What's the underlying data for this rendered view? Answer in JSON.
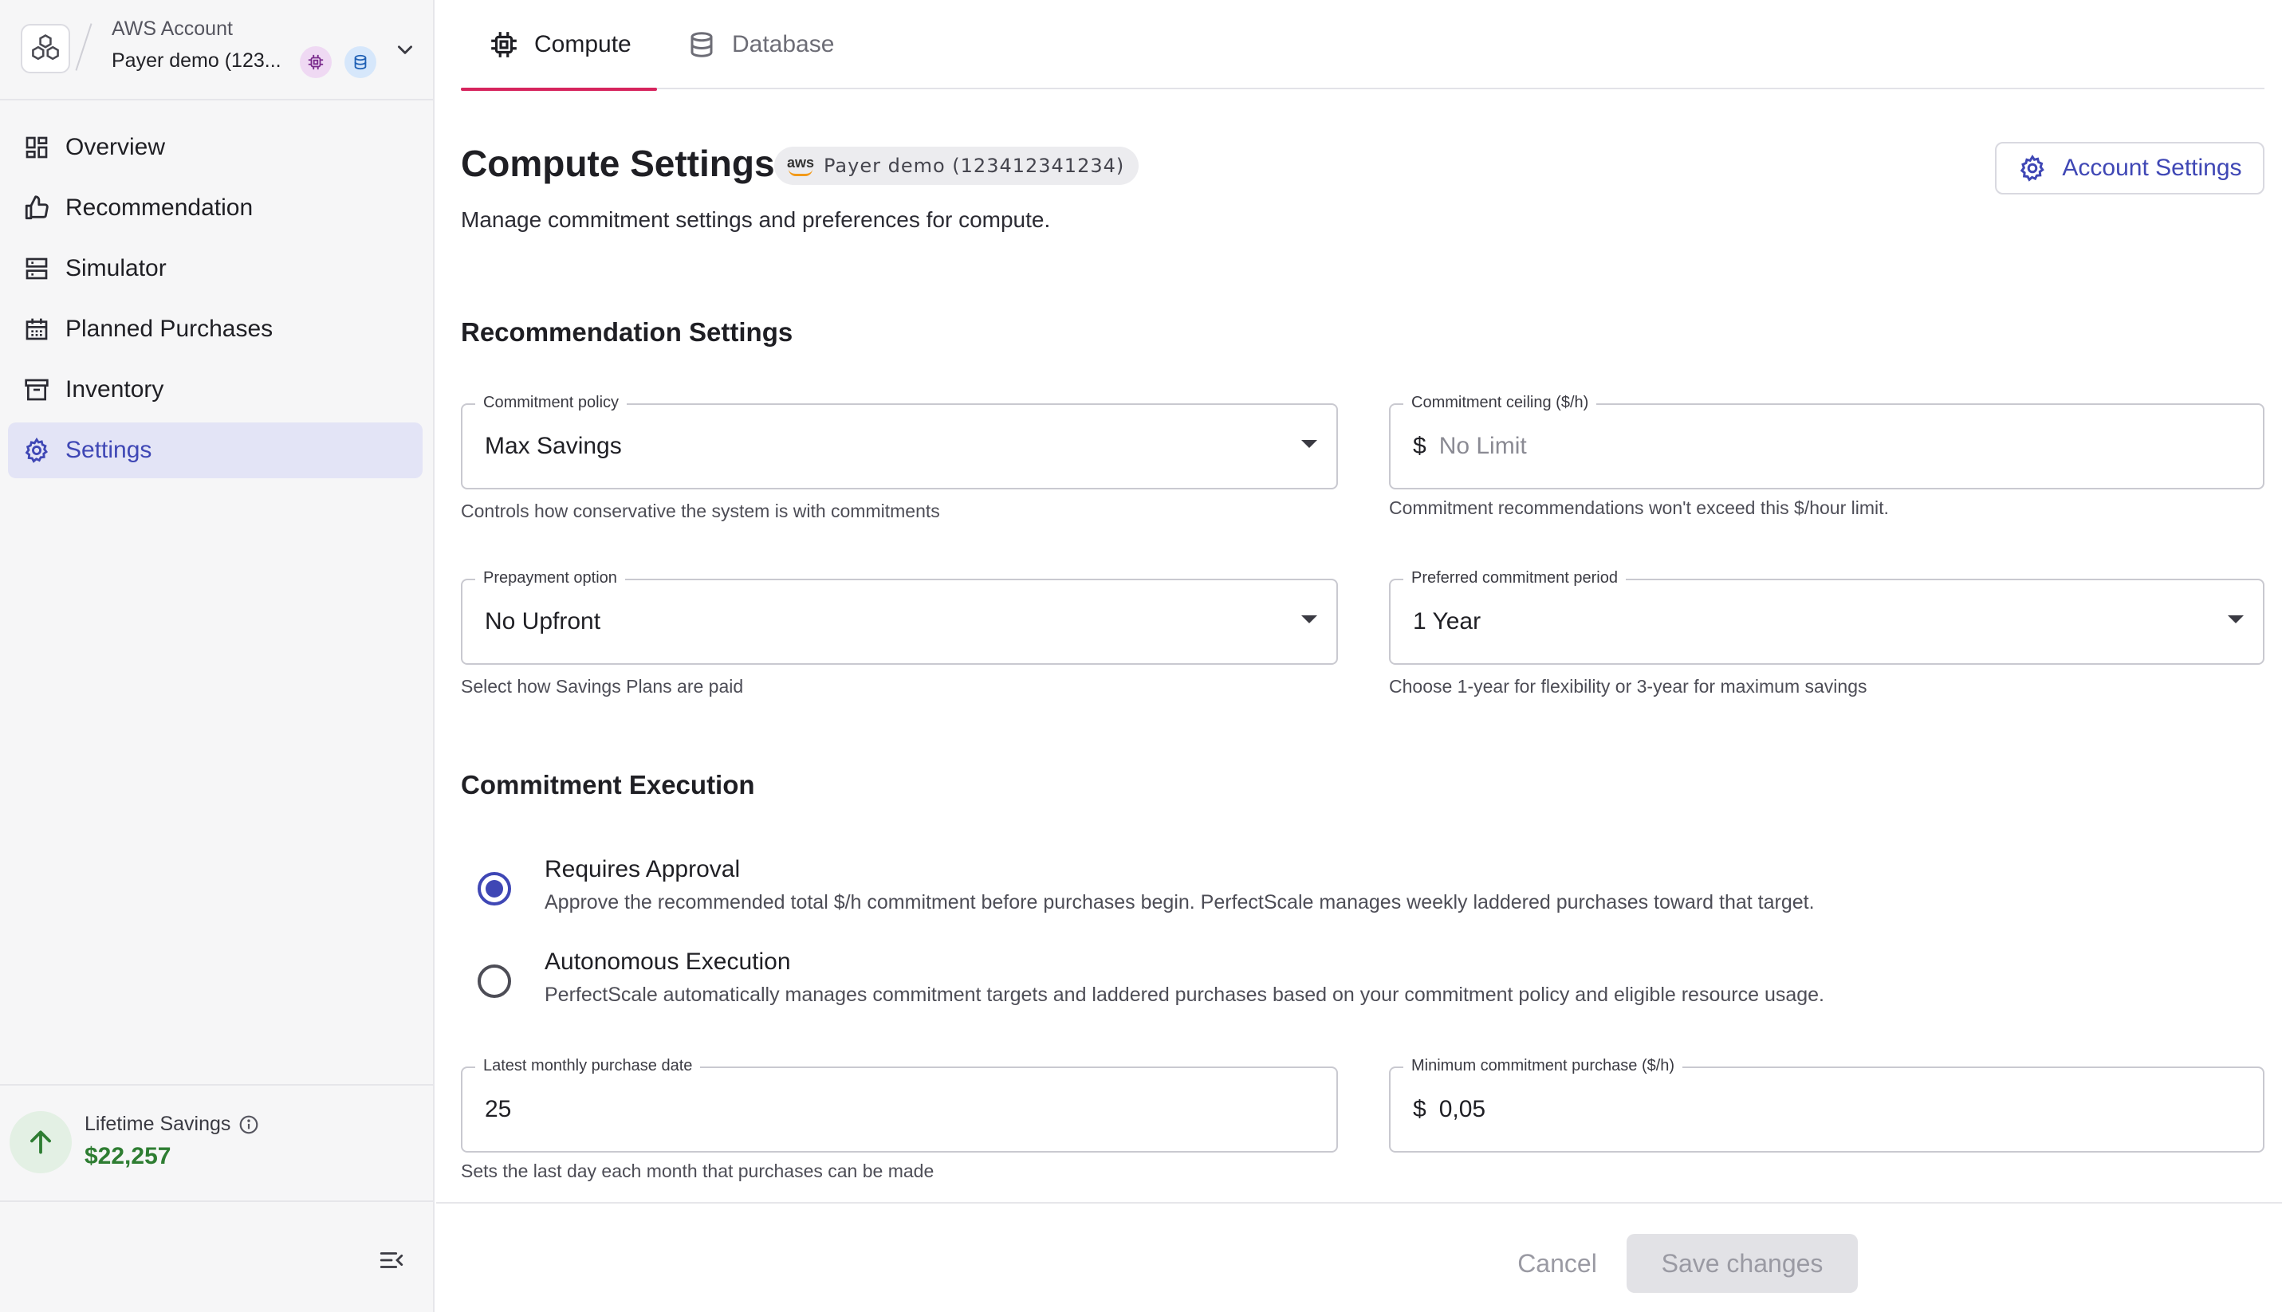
{
  "account": {
    "kicker": "AWS Account",
    "name": "Payer demo (123...",
    "badges": [
      "compute-icon",
      "database-icon"
    ]
  },
  "sidebar": {
    "items": [
      {
        "label": "Overview",
        "icon": "dashboard-icon",
        "active": false
      },
      {
        "label": "Recommendation",
        "icon": "thumbs-up-icon",
        "active": false
      },
      {
        "label": "Simulator",
        "icon": "server-icon",
        "active": false
      },
      {
        "label": "Planned Purchases",
        "icon": "calendar-icon",
        "active": false
      },
      {
        "label": "Inventory",
        "icon": "archive-icon",
        "active": false
      },
      {
        "label": "Settings",
        "icon": "gear-icon",
        "active": true
      }
    ],
    "savings": {
      "label": "Lifetime Savings",
      "value": "$22,257"
    }
  },
  "tabs": [
    {
      "label": "Compute",
      "icon": "chip-icon",
      "active": true
    },
    {
      "label": "Database",
      "icon": "database-icon",
      "active": false
    }
  ],
  "header": {
    "title": "Compute Settings",
    "account_chip": "Payer demo (123412341234)",
    "account_chip_logo": "aws",
    "account_settings_label": "Account Settings",
    "subtitle": "Manage commitment settings and preferences for compute."
  },
  "recommendation": {
    "title": "Recommendation Settings",
    "commitment_policy": {
      "label": "Commitment policy",
      "value": "Max Savings",
      "helper": "Controls how conservative the system is with commitments"
    },
    "commitment_ceiling": {
      "label": "Commitment ceiling ($/h)",
      "prefix": "$",
      "placeholder": "No Limit",
      "helper": "Commitment recommendations won't exceed this $/hour limit."
    },
    "prepayment": {
      "label": "Prepayment option",
      "value": "No Upfront",
      "helper": "Select how Savings Plans are paid"
    },
    "period": {
      "label": "Preferred commitment period",
      "value": "1 Year",
      "helper": "Choose 1-year for flexibility or 3-year for maximum savings"
    }
  },
  "execution": {
    "title": "Commitment Execution",
    "options": [
      {
        "title": "Requires Approval",
        "desc": "Approve the recommended total $/h commitment before purchases begin. PerfectScale manages weekly laddered purchases toward that target.",
        "selected": true
      },
      {
        "title": "Autonomous Execution",
        "desc": "PerfectScale automatically manages commitment targets and laddered purchases based on your commitment policy and eligible resource usage.",
        "selected": false
      }
    ],
    "purchase_date": {
      "label": "Latest monthly purchase date",
      "value": "25",
      "helper": "Sets the last day each month that purchases can be made"
    },
    "min_purchase": {
      "label": "Minimum commitment purchase ($/h)",
      "prefix": "$",
      "value": "0,05"
    }
  },
  "footer": {
    "cancel_label": "Cancel",
    "save_label": "Save changes"
  },
  "colors": {
    "accent": "#3f47b5",
    "tab_underline": "#d6245d",
    "savings": "#2e7d32"
  }
}
